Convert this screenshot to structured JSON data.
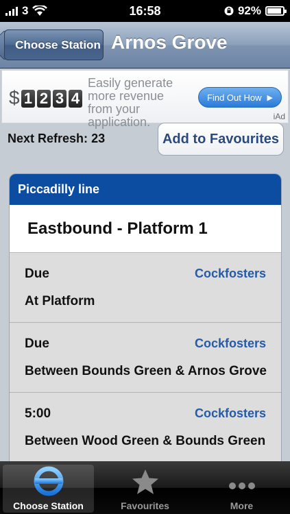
{
  "status_bar": {
    "carrier": "3",
    "time": "16:58",
    "battery_percent": "92%",
    "battery_level": 0.92
  },
  "nav": {
    "back_label": "Choose Station",
    "title": "Arnos Grove"
  },
  "ad": {
    "dollar": "$",
    "digits": [
      "1",
      "2",
      "3",
      "4"
    ],
    "text": "Easily generate more revenue from your application.",
    "cta": "Find Out How",
    "badge": "iAd"
  },
  "refresh": {
    "label": "Next Refresh:",
    "value": "23"
  },
  "favourites_button": "Add to Favourites",
  "line": {
    "name": "Piccadilly line",
    "color": "#0c4da2",
    "platform": "Eastbound - Platform 1",
    "arrivals": [
      {
        "due": "Due",
        "destination": "Cockfosters",
        "location": "At Platform"
      },
      {
        "due": "Due",
        "destination": "Cockfosters",
        "location": "Between Bounds Green & Arnos Grove"
      },
      {
        "due": "5:00",
        "destination": "Cockfosters",
        "location": "Between Wood Green & Bounds Green"
      }
    ]
  },
  "tabs": [
    {
      "label": "Choose Station",
      "icon": "tube-roundel-icon",
      "selected": true
    },
    {
      "label": "Favourites",
      "icon": "star-icon",
      "selected": false
    },
    {
      "label": "More",
      "icon": "more-dots-icon",
      "selected": false
    }
  ]
}
